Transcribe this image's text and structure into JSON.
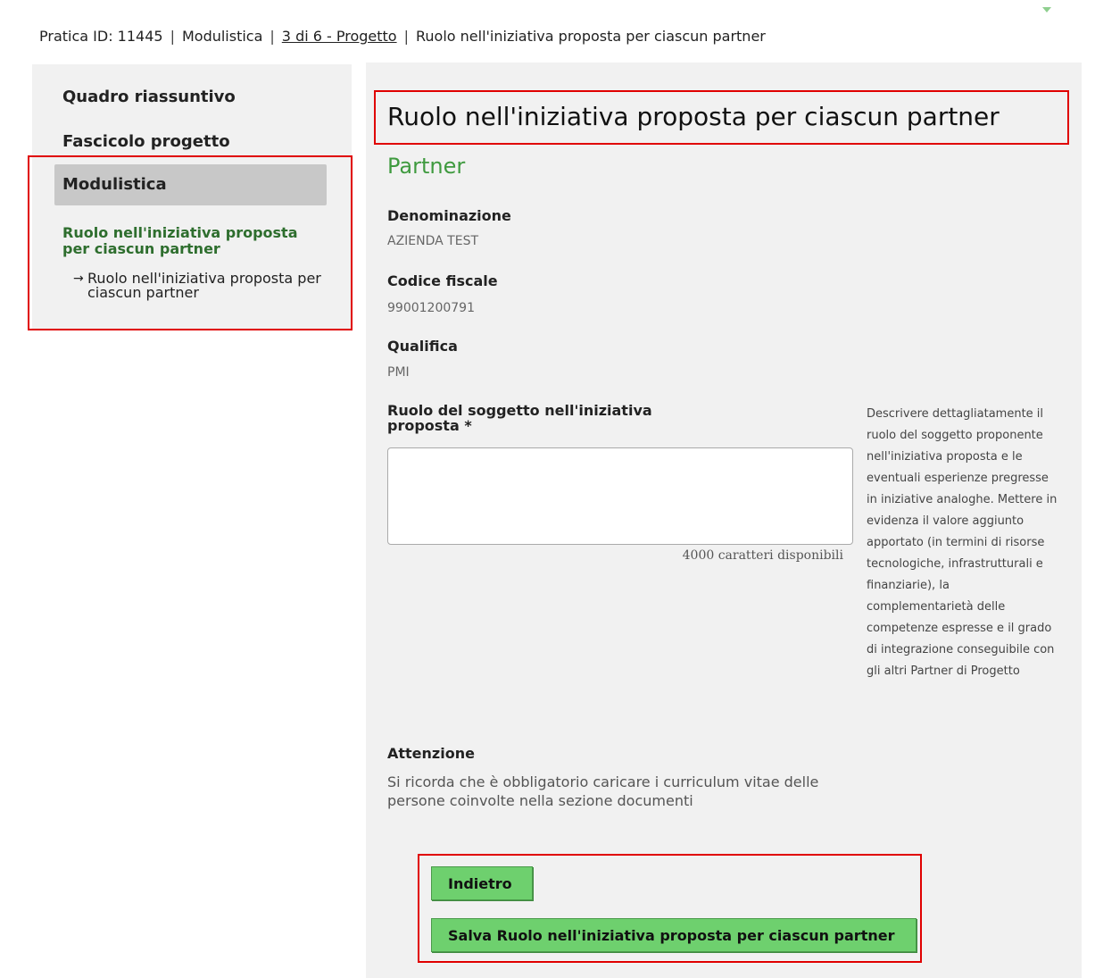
{
  "breadcrumb": {
    "pratica": "Pratica ID: 11445",
    "modulistica": "Modulistica",
    "step_link": "3 di 6 - Progetto",
    "current": "Ruolo nell'iniziativa proposta per ciascun partner",
    "separator": "|"
  },
  "sidebar": {
    "items": [
      {
        "label": "Quadro riassuntivo"
      },
      {
        "label": "Fascicolo progetto"
      },
      {
        "label": "Modulistica"
      }
    ],
    "sub_section": "Ruolo nell'iniziativa proposta per ciascun partner",
    "sub_item": "Ruolo nell'iniziativa proposta per ciascun partner",
    "arrow": "→"
  },
  "main": {
    "title": "Ruolo nell'iniziativa proposta per ciascun partner",
    "section": "Partner",
    "fields": [
      {
        "label": "Denominazione",
        "value": "AZIENDA TEST"
      },
      {
        "label": "Codice fiscale",
        "value": "99001200791"
      },
      {
        "label": "Qualifica",
        "value": "PMI"
      }
    ],
    "ruolo": {
      "label": "Ruolo del soggetto nell'iniziativa proposta *",
      "value": "",
      "chars_available": "4000 caratteri disponibili",
      "help": "Descrivere dettagliatamente il ruolo del soggetto proponente nell'iniziativa proposta e le eventuali esperienze pregresse in iniziative analoghe. Mettere in evidenza il valore aggiunto apportato (in termini di risorse tecnologiche, infrastrutturali e finanziarie), la complementarietà delle competenze espresse e il grado di integrazione conseguibile con gli altri Partner di Progetto"
    },
    "attention": {
      "title": "Attenzione",
      "text": "Si ricorda che è obbligatorio caricare i curriculum vitae delle persone coinvolte nella sezione documenti"
    },
    "buttons": {
      "back": "Indietro",
      "save": "Salva Ruolo nell'iniziativa proposta per ciascun partner"
    }
  },
  "colors": {
    "highlight_border": "#e00000",
    "button_green": "#6ed06e",
    "section_green": "#3f9a3f",
    "panel_bg": "#f1f1f1"
  }
}
